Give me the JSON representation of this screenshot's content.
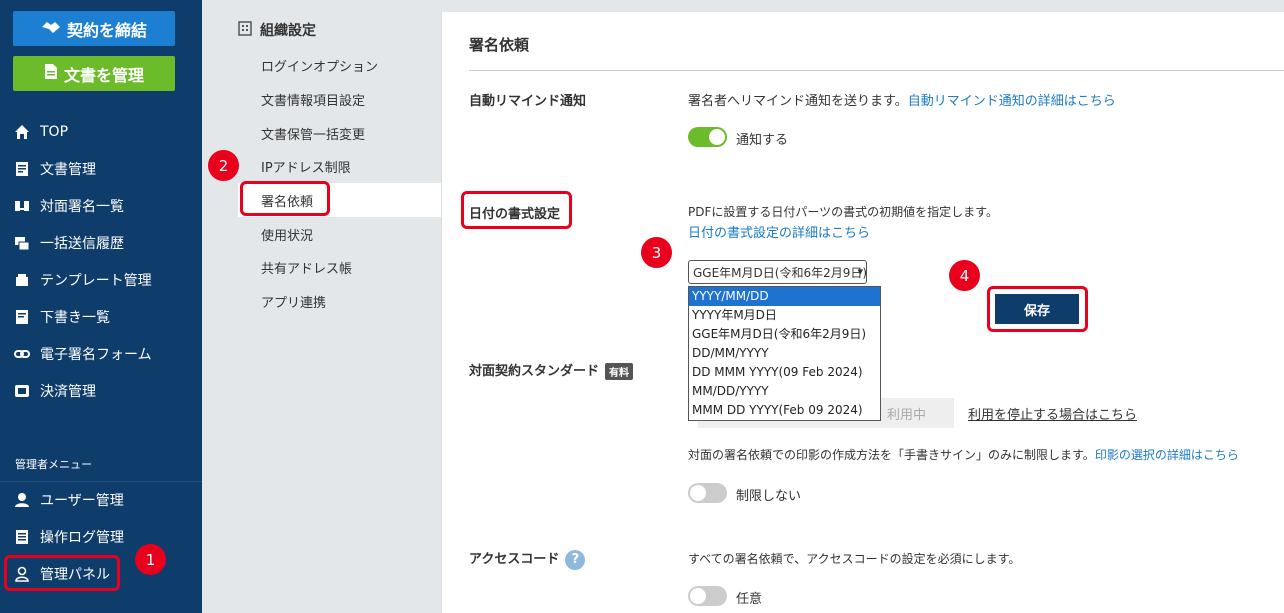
{
  "sidebar": {
    "contract_button": "契約を締結",
    "docs_button": "文書を管理",
    "items": [
      {
        "label": "TOP",
        "icon": "home-icon"
      },
      {
        "label": "文書管理",
        "icon": "document-icon"
      },
      {
        "label": "対面署名一覧",
        "icon": "face-to-face-icon"
      },
      {
        "label": "一括送信履歴",
        "icon": "bulk-send-icon"
      },
      {
        "label": "テンプレート管理",
        "icon": "template-icon"
      },
      {
        "label": "下書き一覧",
        "icon": "draft-icon"
      },
      {
        "label": "電子署名フォーム",
        "icon": "link-icon"
      },
      {
        "label": "決済管理",
        "icon": "payment-icon"
      }
    ],
    "admin_menu_label": "管理者メニュー",
    "admin_items": [
      {
        "label": "ユーザー管理",
        "icon": "user-icon"
      },
      {
        "label": "操作ログ管理",
        "icon": "log-icon"
      },
      {
        "label": "管理パネル",
        "icon": "admin-panel-icon"
      }
    ]
  },
  "subnav": {
    "title": "組織設定",
    "items": [
      "ログインオプション",
      "文書情報項目設定",
      "文書保管一括変更",
      "IPアドレス制限",
      "署名依頼",
      "使用状況",
      "共有アドレス帳",
      "アプリ連携"
    ]
  },
  "badges": [
    "1",
    "2",
    "3",
    "4"
  ],
  "panel": {
    "title": "署名依頼",
    "reminder": {
      "label": "自動リマインド通知",
      "desc": "署名者へリマインド通知を送ります。",
      "link": "自動リマインド通知の詳細はこちら",
      "toggle_label": "通知する",
      "toggle_on": true
    },
    "date_format": {
      "label": "日付の書式設定",
      "desc": "PDFに設置する日付パーツの書式の初期値を指定します。",
      "link": "日付の書式設定の詳細はこちら",
      "selected": "GGE年M月D日(令和6年2月9日)",
      "options": [
        "YYYY/MM/DD",
        "YYYY年M月D日",
        "GGE年M月D日(令和6年2月9日)",
        "DD/MM/YYYY",
        "DD MMM YYYY(09 Feb 2024)",
        "MM/DD/YYYY",
        "MMM DD YYYY(Feb 09 2024)"
      ],
      "highlighted_option": "YYYY/MM/DD"
    },
    "save_button": "保存",
    "face_to_face": {
      "label": "対面契約スタンダード",
      "tag": "有料",
      "field_text": "利用中",
      "stop_link": "利用を停止する場合はこちら",
      "desc": "対面の署名依頼での印影の作成方法を「手書きサイン」のみに制限します。",
      "desc_link": "印影の選択の詳細はこちら",
      "toggle_label": "制限しない",
      "toggle_on": false
    },
    "access_code": {
      "label": "アクセスコード",
      "help": "?",
      "desc": "すべての署名依頼で、アクセスコードの設定を必須にします。",
      "toggle_label": "任意",
      "toggle_on": false
    }
  },
  "colors": {
    "sidebar_bg": "#0f3d6b",
    "contract_btn": "#1d7fd2",
    "docs_btn": "#6cbb2b",
    "highlight": "#e8001c",
    "link": "#1a7bc7"
  }
}
